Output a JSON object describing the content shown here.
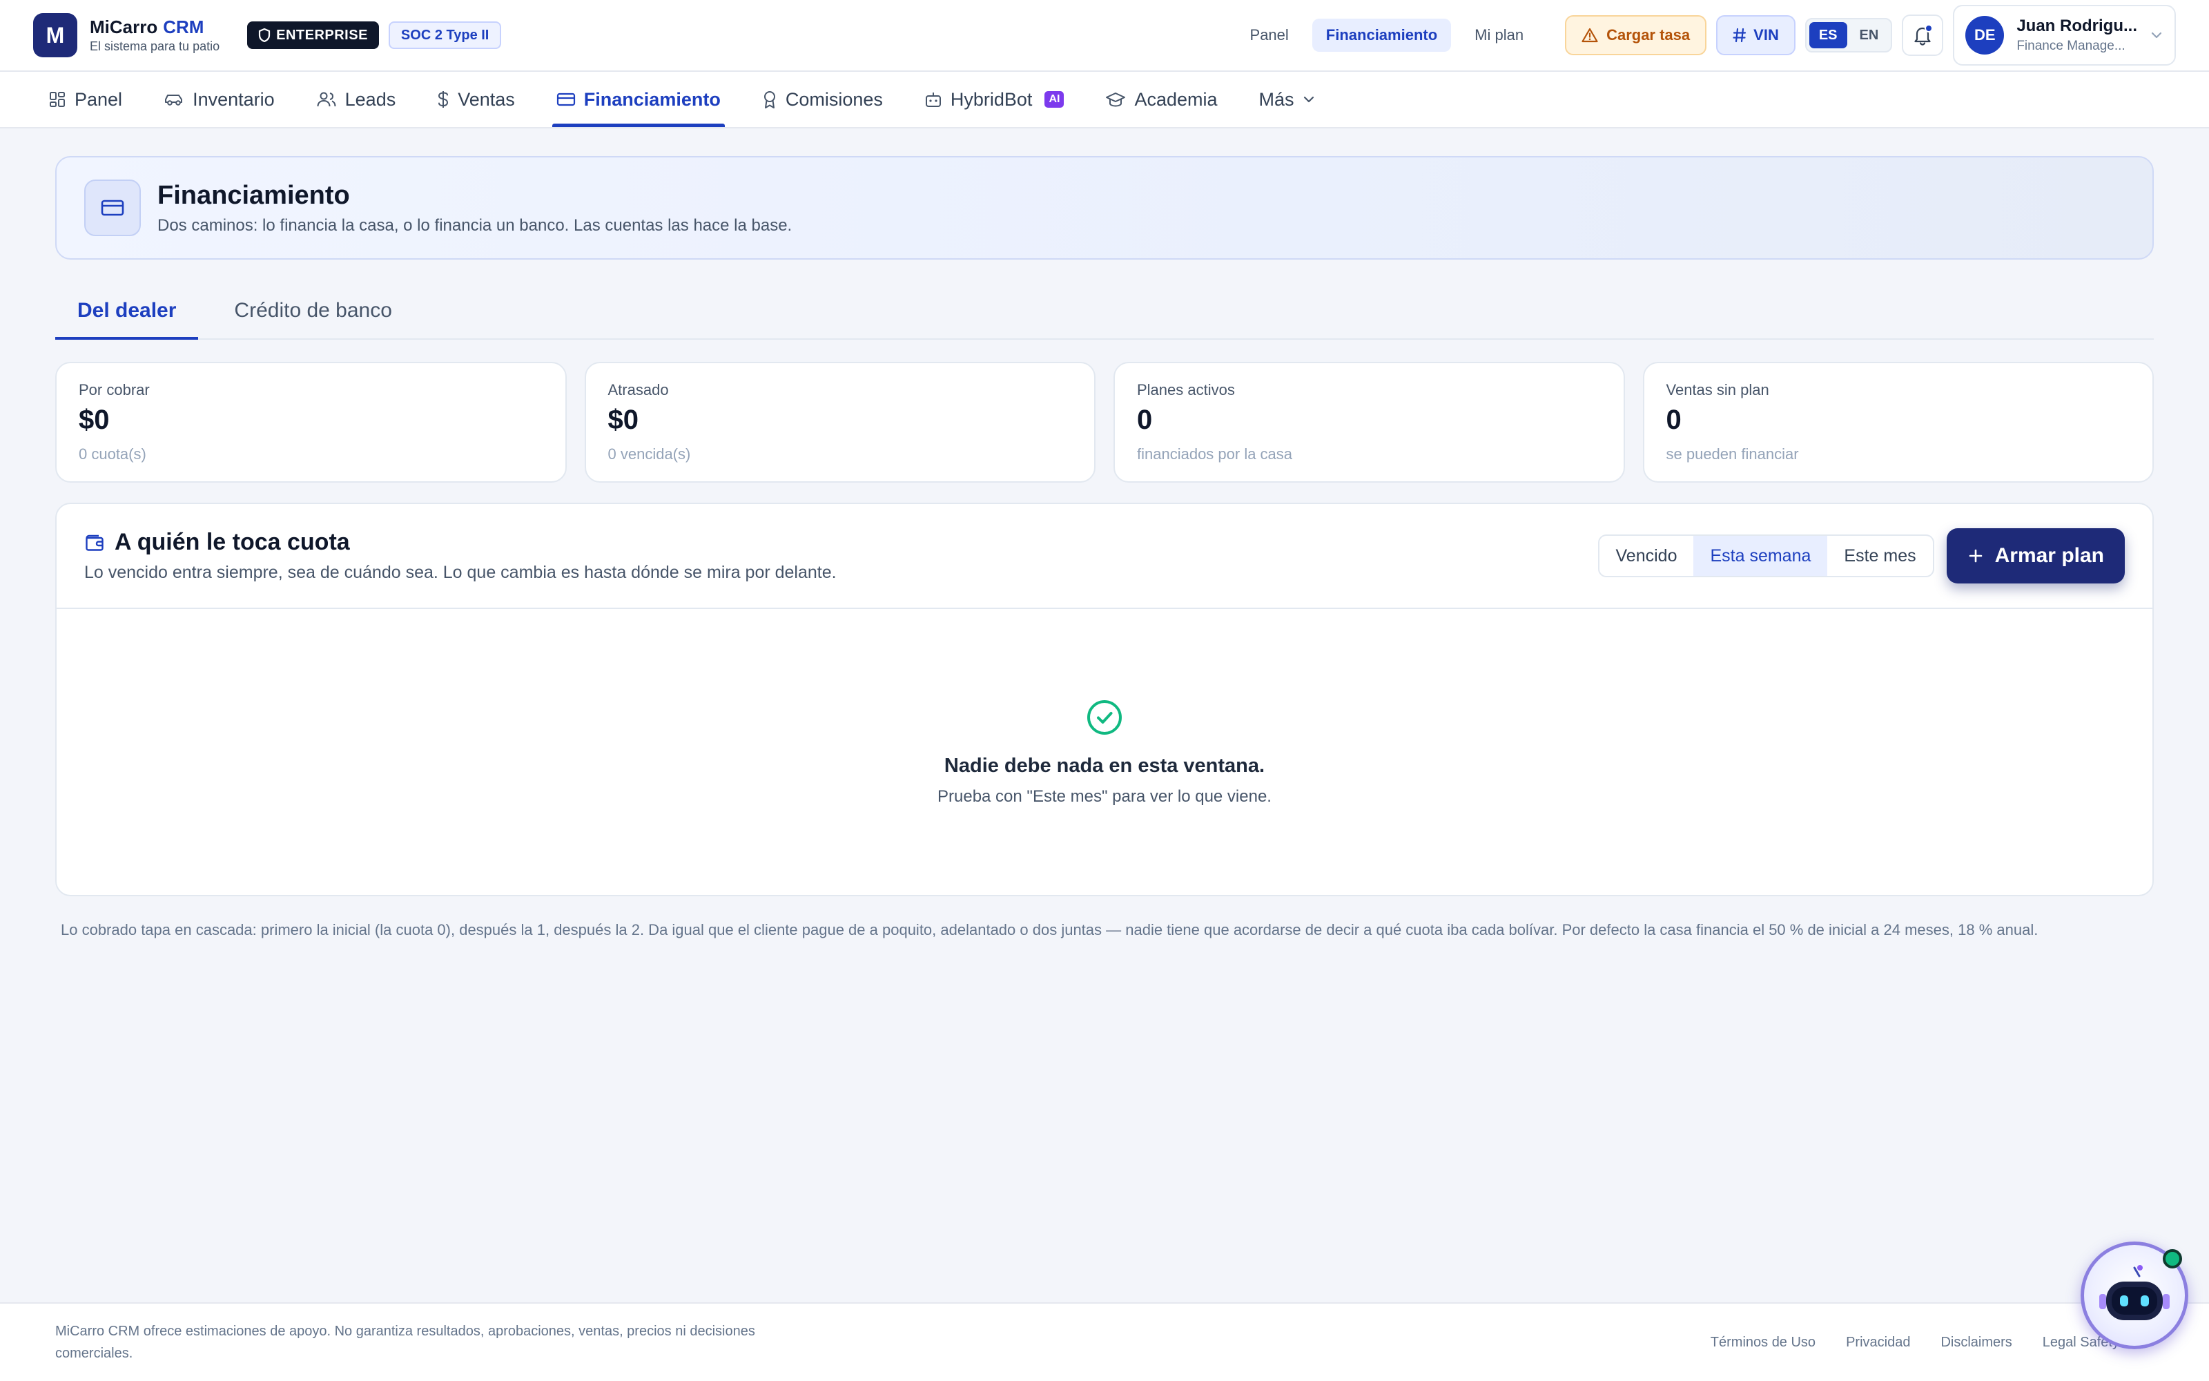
{
  "brand": {
    "logo_letter": "M",
    "name": "MiCarro",
    "suffix": "CRM",
    "tagline": "El sistema para tu patio",
    "enterprise_badge": "ENTERPRISE",
    "compliance_badge": "SOC 2 Type II"
  },
  "header": {
    "quick_links": [
      "Panel",
      "Financiamiento",
      "Mi plan"
    ],
    "active_quick_link": "Financiamiento",
    "rate_button": "Cargar tasa",
    "vin_button": "VIN",
    "languages": [
      "ES",
      "EN"
    ],
    "active_language": "ES",
    "user": {
      "initials": "DE",
      "name": "Juan Rodrigu...",
      "role": "Finance Manage..."
    }
  },
  "nav": {
    "items": [
      {
        "label": "Panel",
        "icon": "grid-icon"
      },
      {
        "label": "Inventario",
        "icon": "car-icon"
      },
      {
        "label": "Leads",
        "icon": "users-icon"
      },
      {
        "label": "Ventas",
        "icon": "dollar-icon"
      },
      {
        "label": "Financiamiento",
        "icon": "credit-card-icon"
      },
      {
        "label": "Comisiones",
        "icon": "award-icon"
      },
      {
        "label": "HybridBot",
        "icon": "bot-icon",
        "badge": "AI"
      },
      {
        "label": "Academia",
        "icon": "graduation-cap-icon"
      },
      {
        "label": "Más",
        "icon": "chevron-down-icon"
      }
    ],
    "active": "Financiamiento"
  },
  "page": {
    "title": "Financiamiento",
    "subtitle": "Dos caminos: lo financia la casa, o lo financia un banco. Las cuentas las hace la base."
  },
  "tabs": {
    "items": [
      "Del dealer",
      "Crédito de banco"
    ],
    "active": "Del dealer"
  },
  "stats": [
    {
      "label": "Por cobrar",
      "value": "$0",
      "hint": "0 cuota(s)"
    },
    {
      "label": "Atrasado",
      "value": "$0",
      "hint": "0 vencida(s)"
    },
    {
      "label": "Planes activos",
      "value": "0",
      "hint": "financiados por la casa"
    },
    {
      "label": "Ventas sin plan",
      "value": "0",
      "hint": "se pueden financiar"
    }
  ],
  "schedule": {
    "title": "A quién le toca cuota",
    "subtitle": "Lo vencido entra siempre, sea de cuándo sea. Lo que cambia es hasta dónde se mira por delante.",
    "filters": [
      "Vencido",
      "Esta semana",
      "Este mes"
    ],
    "active_filter": "Esta semana",
    "primary_button": "Armar plan",
    "empty_title": "Nadie debe nada en esta ventana.",
    "empty_subtitle": "Prueba con \"Este mes\" para ver lo que viene."
  },
  "footnote": "Lo cobrado tapa en cascada: primero la inicial (la cuota 0), después la 1, después la 2. Da igual que el cliente pague de a poquito, adelantado o dos juntas — nadie tiene que acordarse de decir a qué cuota iba cada bolívar. Por defecto la casa financia el 50 % de inicial a 24 meses, 18 % anual.",
  "footer": {
    "disclaimer": "MiCarro CRM ofrece estimaciones de apoyo. No garantiza resultados, aprobaciones, ventas, precios ni decisiones comerciales.",
    "links": [
      "Términos de Uso",
      "Privacidad",
      "Disclaimers",
      "Legal Safety"
    ]
  },
  "colors": {
    "primary": "#1d3fbf",
    "primary_dark": "#1e2a78",
    "background": "#f3f5fa",
    "success": "#10b981",
    "warning_text": "#b45309",
    "ai_badge": "#7c3aed"
  }
}
